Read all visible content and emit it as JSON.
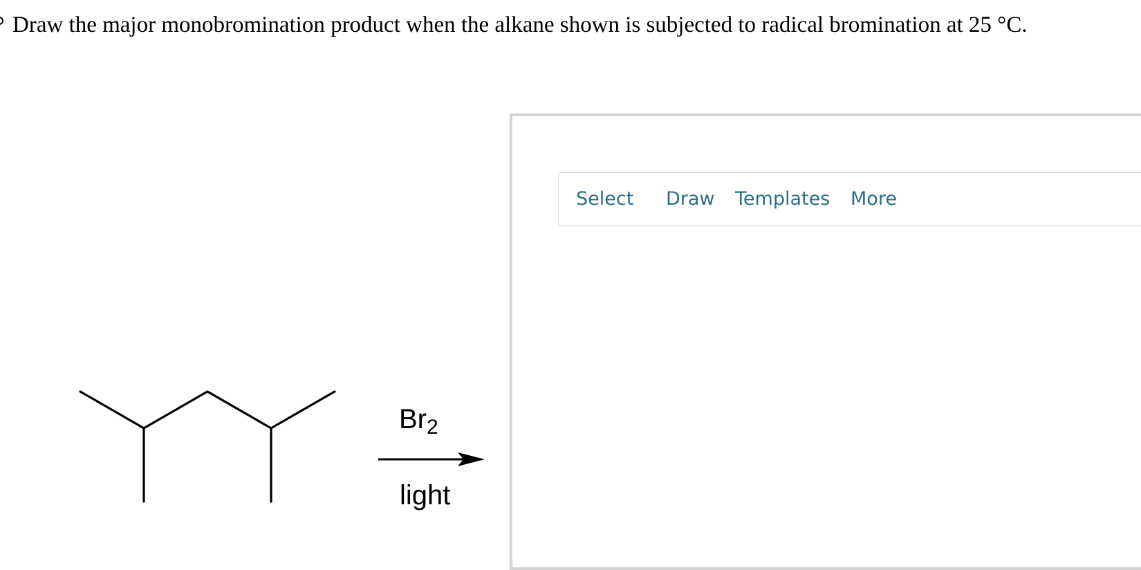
{
  "question": {
    "text": "Draw the major monobromination product when the alkane shown is subjected to radical bromination at 25 °C."
  },
  "reaction": {
    "reagent_symbol": "Br",
    "reagent_subscript": "2",
    "condition": "light"
  },
  "toolbar": {
    "items": [
      {
        "label": "Select"
      },
      {
        "label": "Draw"
      },
      {
        "label": "Templates"
      },
      {
        "label": "More"
      }
    ],
    "color": "#2b6f87"
  },
  "canvas": {
    "border_color": "#d4d4d4"
  }
}
